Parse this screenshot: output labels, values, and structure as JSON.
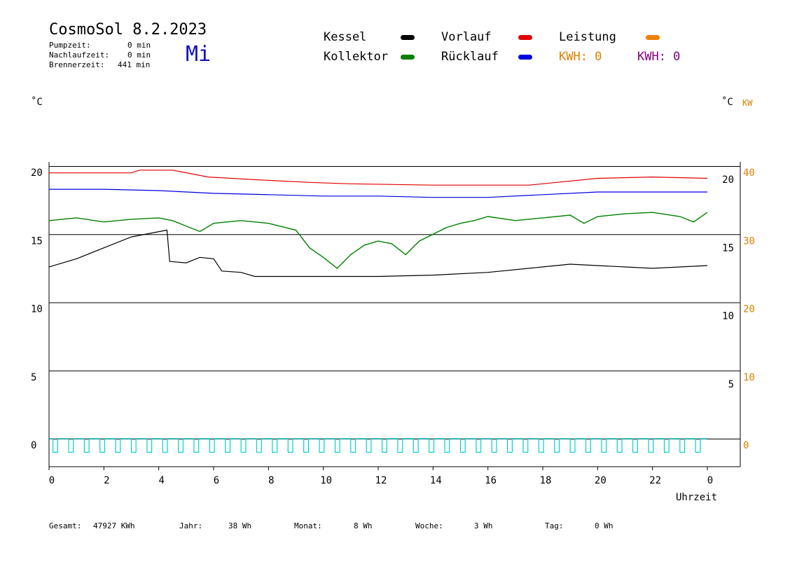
{
  "header": {
    "title": "CosmoSol 8.2.2023",
    "weekday": "Mi",
    "stats": [
      {
        "label": "Pumpzeit:",
        "value": "0 min"
      },
      {
        "label": "Nachlaufzeit:",
        "value": "0 min"
      },
      {
        "label": "Brennerzeit:",
        "value": "441 min"
      }
    ]
  },
  "legend": {
    "kessel": {
      "label": "Kessel",
      "color": "#000000"
    },
    "vorlauf": {
      "label": "Vorlauf",
      "color": "#e00000"
    },
    "leistung": {
      "label": "Leistung",
      "color": "#f08000"
    },
    "kollektor": {
      "label": "Kollektor",
      "color": "#008000"
    },
    "ruecklauf": {
      "label": "Rücklauf",
      "color": "#0000e0"
    },
    "kwh1": {
      "label": "KWH: 0",
      "color": "#e08000"
    },
    "kwh2": {
      "label": "KWH: 0",
      "color": "#800080"
    }
  },
  "axes": {
    "left_unit": "˚C",
    "right_unit_c": "˚C",
    "right_unit_kw": "KW",
    "xlabel": "Uhrzeit"
  },
  "footer": [
    {
      "label": "Gesamt:",
      "value": "47927 KWh"
    },
    {
      "label": "Jahr:",
      "value": "38 Wh"
    },
    {
      "label": "Monat:",
      "value": "8 Wh"
    },
    {
      "label": "Woche:",
      "value": "3 Wh"
    },
    {
      "label": "Tag:",
      "value": "0 Wh"
    }
  ],
  "chart_data": {
    "type": "line",
    "x_unit": "hours",
    "xlim": [
      0,
      24
    ],
    "ylim": [
      -1.5,
      20.5
    ],
    "y2lim": [
      -3,
      41
    ],
    "x_ticks": [
      0,
      2,
      4,
      6,
      8,
      10,
      12,
      14,
      16,
      18,
      20,
      22,
      24
    ],
    "x_tick_labels": [
      "0",
      "2",
      "4",
      "6",
      "8",
      "10",
      "12",
      "14",
      "16",
      "18",
      "20",
      "22",
      "0"
    ],
    "y_ticks": [
      0,
      5,
      10,
      15,
      20
    ],
    "y_tick_labels_left": [
      "0",
      "5",
      "10",
      "15",
      "20"
    ],
    "y_tick_labels_right_c": [
      "5",
      "10",
      "15",
      "20"
    ],
    "y2_ticks": [
      0,
      10,
      20,
      30,
      40
    ],
    "y2_tick_labels": [
      "0",
      "10",
      "20",
      "30",
      "40"
    ],
    "gridlines_y": [
      0,
      5,
      10,
      15,
      20
    ],
    "series": [
      {
        "name": "Vorlauf",
        "color": "#e00000",
        "x": [
          0,
          3,
          3.3,
          4.5,
          5.8,
          7.5,
          9.5,
          11,
          14,
          15,
          17.5,
          18.5,
          20,
          22,
          24
        ],
        "y": [
          19.5,
          19.5,
          19.7,
          19.7,
          19.2,
          19.0,
          18.8,
          18.7,
          18.6,
          18.6,
          18.6,
          18.8,
          19.1,
          19.2,
          19.1
        ]
      },
      {
        "name": "Rücklauf",
        "color": "#0000e0",
        "x": [
          0,
          2,
          4,
          6,
          8,
          10,
          12,
          14,
          16,
          18,
          20,
          22,
          24
        ],
        "y": [
          18.3,
          18.3,
          18.2,
          18.0,
          17.9,
          17.8,
          17.8,
          17.7,
          17.7,
          17.9,
          18.1,
          18.1,
          18.1
        ]
      },
      {
        "name": "Kollektor",
        "color": "#008000",
        "x": [
          0,
          1,
          2,
          3,
          4,
          4.5,
          5,
          5.5,
          6,
          6.5,
          7,
          8,
          9,
          9.5,
          10,
          10.5,
          11,
          11.5,
          12,
          12.5,
          13,
          13.5,
          14,
          14.5,
          15,
          15.5,
          16,
          17,
          18,
          19,
          19.5,
          20,
          21,
          22,
          23,
          23.5,
          24
        ],
        "y": [
          16.0,
          16.2,
          15.9,
          16.1,
          16.2,
          16.0,
          15.6,
          15.2,
          15.8,
          15.9,
          16.0,
          15.8,
          15.3,
          14.0,
          13.3,
          12.5,
          13.5,
          14.2,
          14.5,
          14.3,
          13.5,
          14.5,
          15.0,
          15.5,
          15.8,
          16.0,
          16.3,
          16.0,
          16.2,
          16.4,
          15.8,
          16.3,
          16.5,
          16.6,
          16.3,
          15.9,
          16.6
        ]
      },
      {
        "name": "Kessel",
        "color": "#000000",
        "x": [
          0,
          1,
          2,
          3,
          4.3,
          4.4,
          5,
          5.5,
          6,
          6.3,
          7,
          7.5,
          8,
          10,
          12,
          14,
          16,
          18,
          19,
          20,
          22,
          24
        ],
        "y": [
          12.6,
          13.2,
          14.0,
          14.8,
          15.3,
          13.0,
          12.9,
          13.3,
          13.2,
          12.3,
          12.2,
          11.9,
          11.9,
          11.9,
          11.9,
          12.0,
          12.2,
          12.6,
          12.8,
          12.7,
          12.5,
          12.7
        ]
      },
      {
        "name": "Leistung",
        "color": "#00d0d0",
        "type": "pulses",
        "pulse_count": 42,
        "high": -1.0,
        "low": 0.0
      }
    ]
  }
}
